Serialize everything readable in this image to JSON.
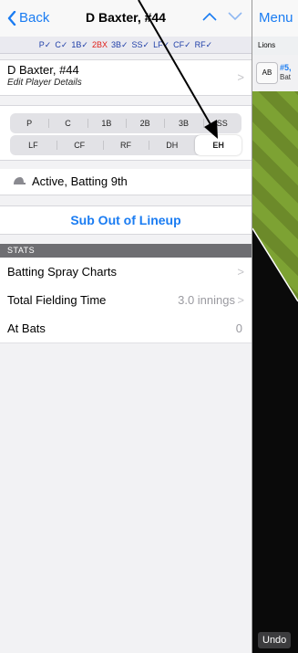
{
  "nav": {
    "back_label": "Back",
    "title": "D Baxter, #44"
  },
  "positions_line": [
    {
      "text": "P✓",
      "bad": false
    },
    {
      "text": "C✓",
      "bad": false
    },
    {
      "text": "1B✓",
      "bad": false
    },
    {
      "text": "2BX",
      "bad": true
    },
    {
      "text": "3B✓",
      "bad": false
    },
    {
      "text": "SS✓",
      "bad": false
    },
    {
      "text": "LF✓",
      "bad": false
    },
    {
      "text": "CF✓",
      "bad": false
    },
    {
      "text": "RF✓",
      "bad": false
    }
  ],
  "player": {
    "name": "D Baxter, #44",
    "subtitle": "Edit Player Details"
  },
  "position_segments": {
    "row1": [
      "P",
      "C",
      "1B",
      "2B",
      "3B",
      "SS"
    ],
    "row2": [
      "LF",
      "CF",
      "RF",
      "DH",
      "EH"
    ],
    "selected": "EH"
  },
  "status": {
    "text": "Active, Batting 9th",
    "icon": "batting-helmet-icon"
  },
  "sub_button_label": "Sub Out of Lineup",
  "stats": {
    "header": "STATS",
    "rows": [
      {
        "label": "Batting Spray Charts",
        "value": ""
      },
      {
        "label": "Total Fielding Time",
        "value": "3.0 innings"
      },
      {
        "label": "At Bats",
        "value": "0"
      }
    ]
  },
  "right_panel": {
    "menu_label": "Menu",
    "team": "Lions",
    "ab_label": "AB",
    "ab_number": "#5,",
    "ab_sub": "Bat",
    "undo_label": "Undo"
  },
  "colors": {
    "accent": "#1a7cf2",
    "error": "#e0201a",
    "stats_header": "#6e6e72"
  }
}
